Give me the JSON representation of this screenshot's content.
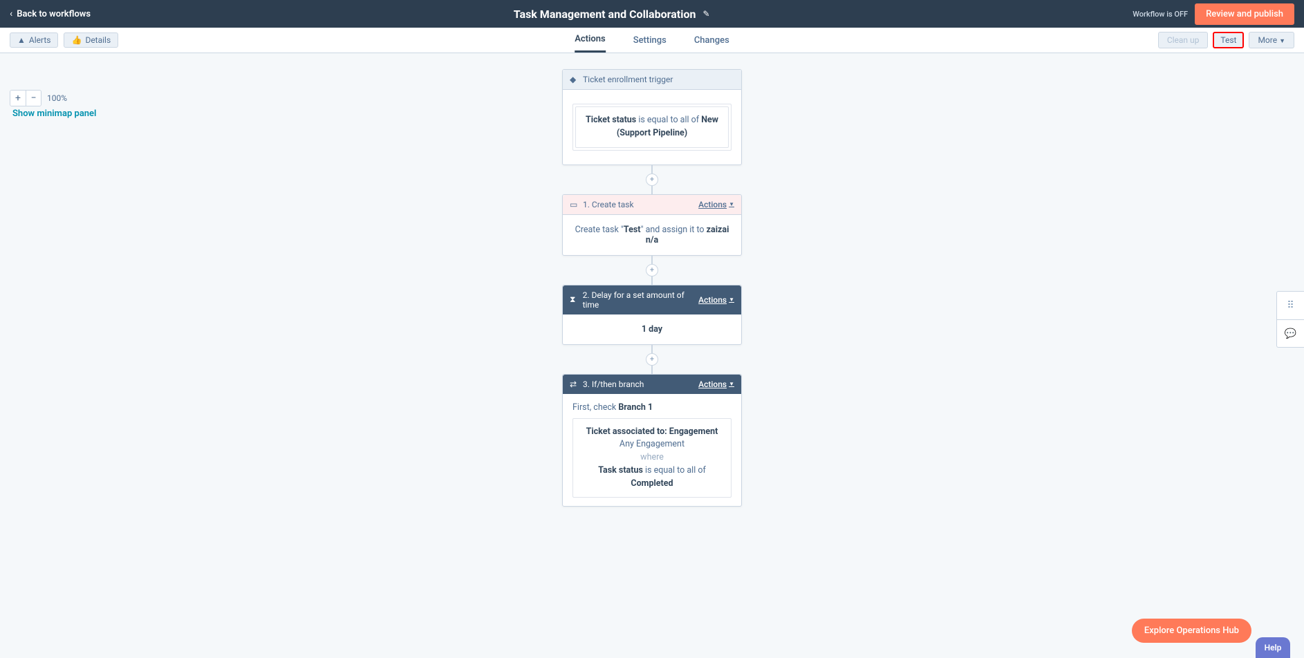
{
  "header": {
    "back_label": "Back to workflows",
    "title": "Task Management and Collaboration",
    "wf_status": "Workflow is OFF",
    "publish_label": "Review and publish"
  },
  "sub": {
    "alerts_label": "Alerts",
    "details_label": "Details",
    "tabs": {
      "actions": "Actions",
      "settings": "Settings",
      "changes": "Changes"
    },
    "cleanup_label": "Clean up",
    "test_label": "Test",
    "more_label": "More"
  },
  "zoom": {
    "pct": "100%",
    "minimap_label": "Show minimap panel"
  },
  "trigger": {
    "header": "Ticket enrollment trigger",
    "inner_prefix": "Ticket status",
    "inner_mid": " is equal to all of ",
    "inner_suffix": "New (Support Pipeline)"
  },
  "step1": {
    "header": "1. Create task",
    "actions": "Actions",
    "body_prefix": "Create task \"",
    "body_bold": "Test",
    "body_mid": "\" and assign it to ",
    "body_assignee": "zaizai n/a"
  },
  "step2": {
    "header": "2. Delay for a set amount of time",
    "actions": "Actions",
    "body": "1 day"
  },
  "step3": {
    "header": "3. If/then branch",
    "actions": "Actions",
    "first_prefix": "First, check ",
    "first_bold": "Branch 1",
    "line1": "Ticket associated to: Engagement",
    "line2": "Any Engagement",
    "line3": "where",
    "line4a": "Task status",
    "line4b": " is equal to all of",
    "line5": "Completed"
  },
  "bottom": {
    "explore": "Explore Operations Hub",
    "help": "Help"
  }
}
